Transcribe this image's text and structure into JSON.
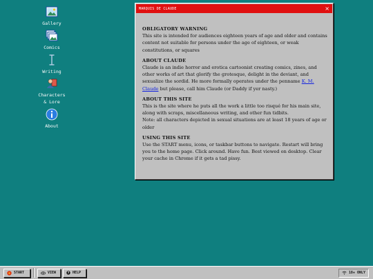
{
  "desktop": {
    "icons": [
      {
        "name": "gallery",
        "label": "Gallery",
        "icon": "picture-icon"
      },
      {
        "name": "comics",
        "label": "Comics",
        "icon": "stacked-pictures-icon"
      },
      {
        "name": "writing",
        "label": "Writing",
        "icon": "text-cursor-icon"
      },
      {
        "name": "characters-lore",
        "label": "Characters\n& Lore",
        "icon": "person-book-icon"
      },
      {
        "name": "about",
        "label": "About",
        "icon": "info-icon"
      }
    ]
  },
  "window": {
    "title": "MARQUIS DE CLAUDE",
    "close_label": "×",
    "sections": {
      "warning": {
        "heading": "OBLIGATORY WARNING",
        "body": "This site is intended for audiences eighteen years of age and older and contains content not suitable for persons under the age of eighteen, or weak constitutions, or squares"
      },
      "about": {
        "heading": "ABOUT CLAUDE",
        "body_before": "Claude is an indie horror and erotica cartoonist creating comics, zines, and other works of art that glorify the grotesque, delight in the deviant, and sexualize the sordid. He more formally operates under the penname ",
        "link": "K. M. Claude",
        "body_after": " but please, call him Claude (or Daddy if yer nasty.)"
      },
      "site": {
        "heading": "ABOUT THIS SITE",
        "body": "This is the site where he puts all the work a little too risqué for his main site, along with scraps, miscellaneous writing, and other fun tidbits.",
        "note": "Note: all characters depicted in sexual situations are at least 18 years of age or older"
      },
      "using": {
        "heading": "USING THIS SITE",
        "body": "Use the START menu, icons, or taskbar buttons to navigate. Restart will bring you to the home page. Click around. Have fun. Best viewed on desktop. Clear your cache in Chrome if it gets a tad pissy."
      }
    }
  },
  "taskbar": {
    "start_label": "START",
    "view_label": "VIEW",
    "help_label": "HELP",
    "tray_label": "18+ ONLY"
  },
  "colors": {
    "desktop": "#0f7f7f",
    "titlebar": "#e01010",
    "window": "#c0c0c0",
    "link": "#1020e0"
  }
}
